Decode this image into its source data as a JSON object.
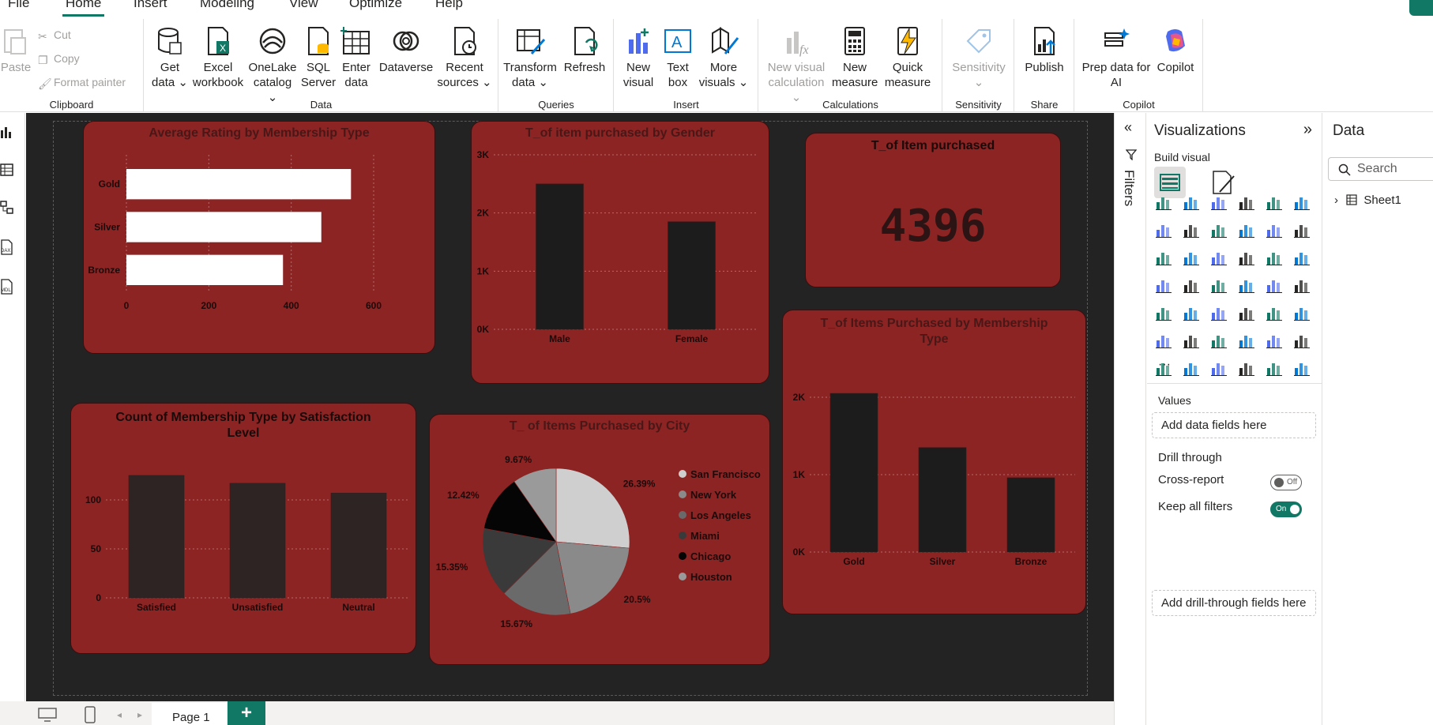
{
  "menu": [
    "File",
    "Home",
    "Insert",
    "Modeling",
    "View",
    "Optimize",
    "Help"
  ],
  "ribbon": {
    "clipboard": {
      "label": "Clipboard",
      "paste": "Paste",
      "cut": "Cut",
      "copy": "Copy",
      "format_painter": "Format painter"
    },
    "data": {
      "label": "Data",
      "get_data": [
        "Get",
        "data ⌄"
      ],
      "excel": [
        "Excel",
        "workbook"
      ],
      "onelake": [
        "OneLake",
        "catalog ⌄"
      ],
      "sql": [
        "SQL",
        "Server"
      ],
      "enter": [
        "Enter",
        "data"
      ],
      "dataverse": [
        "Dataverse"
      ],
      "recent": [
        "Recent",
        "sources ⌄"
      ]
    },
    "queries": {
      "label": "Queries",
      "transform": [
        "Transform",
        "data ⌄"
      ],
      "refresh": [
        "Refresh"
      ]
    },
    "insert": {
      "label": "Insert",
      "new_visual": [
        "New",
        "visual"
      ],
      "text_box": [
        "Text",
        "box"
      ],
      "more": [
        "More",
        "visuals ⌄"
      ]
    },
    "calculations": {
      "label": "Calculations",
      "new_visual_calc": [
        "New visual",
        "calculation ⌄"
      ],
      "new_measure": [
        "New",
        "measure"
      ],
      "quick": [
        "Quick",
        "measure"
      ]
    },
    "sensitivity": {
      "label": "Sensitivity",
      "btn": [
        "Sensitivity",
        "⌄"
      ]
    },
    "share": {
      "label": "Share",
      "publish": [
        "Publish"
      ]
    },
    "copilot": {
      "label": "Copilot",
      "prep": [
        "Prep data for",
        "AI"
      ],
      "copilot": [
        "Copilot"
      ]
    }
  },
  "cards": {
    "rating": {
      "title": "Average Rating by Membership Type"
    },
    "gender": {
      "title": "T_of item purchased by Gender"
    },
    "kpi": {
      "title": "T_of Item purchased",
      "value": "4396"
    },
    "membership_items": {
      "title": "T_of Items Purchased by Membership Type"
    },
    "satisfaction": {
      "title": "Count of Membership Type by Satisfaction Level"
    },
    "city": {
      "title": "T_ of Items Purchased by City"
    }
  },
  "chart_data": [
    {
      "type": "bar",
      "title": "Average Rating by Membership Type",
      "orientation": "horizontal",
      "categories": [
        "Gold",
        "Silver",
        "Bronze"
      ],
      "values": [
        545,
        473,
        380
      ],
      "xlim": [
        0,
        600
      ],
      "ticks": [
        "0",
        "200",
        "400",
        "600"
      ],
      "color": "#ffffff"
    },
    {
      "type": "bar",
      "title": "T_of item purchased by Gender",
      "categories": [
        "Male",
        "Female"
      ],
      "values": [
        2500,
        1850
      ],
      "ylim": [
        0,
        3000
      ],
      "ticks": [
        "0K",
        "1K",
        "2K",
        "3K"
      ],
      "color": "#1c1c1c"
    },
    {
      "type": "bar",
      "title": "T_of Items Purchased by Membership Type",
      "categories": [
        "Gold",
        "Silver",
        "Bronze"
      ],
      "values": [
        2050,
        1350,
        960
      ],
      "ylim": [
        0,
        2000
      ],
      "ticks": [
        "0K",
        "1K",
        "2K"
      ],
      "color": "#1c1c1c"
    },
    {
      "type": "bar",
      "title": "Count of Membership Type by Satisfaction Level",
      "categories": [
        "Satisfied",
        "Unsatisfied",
        "Neutral"
      ],
      "values": [
        125,
        117,
        107
      ],
      "ylim": [
        0,
        100
      ],
      "ticks": [
        "0",
        "50",
        "100"
      ],
      "color": "#2e2424"
    },
    {
      "type": "pie",
      "title": "T_ of Items Purchased by City",
      "labels": [
        "San Francisco",
        "New York",
        "Los Angeles",
        "Miami",
        "Chicago",
        "Houston"
      ],
      "values": [
        26.39,
        20.5,
        15.67,
        15.35,
        12.42,
        9.67
      ],
      "value_labels": [
        "26.39%",
        "20.5%",
        "15.67%",
        "15.35%",
        "12.42%",
        "9.67%"
      ],
      "colors": [
        "#cfcfcf",
        "#8a8a8a",
        "#6a6a6a",
        "#3a3a3a",
        "#050505",
        "#9a9a9a"
      ]
    }
  ],
  "filters": {
    "label": "Filters"
  },
  "viz": {
    "title": "Visualizations",
    "build": "Build visual",
    "values_label": "Values",
    "values_field": "Add data fields here",
    "drill": "Drill through",
    "cross": "Cross-report",
    "cross_state": "Off",
    "keep": "Keep all filters",
    "keep_state": "On",
    "drill_field": "Add drill-through fields here",
    "more": "···"
  },
  "data_pane": {
    "title": "Data",
    "search": "Search",
    "table": "Sheet1"
  },
  "bottom": {
    "page": "Page 1",
    "add": "+"
  },
  "colors": {
    "accent": "#117865",
    "card": "#8c2424",
    "canvas": "#232323"
  }
}
